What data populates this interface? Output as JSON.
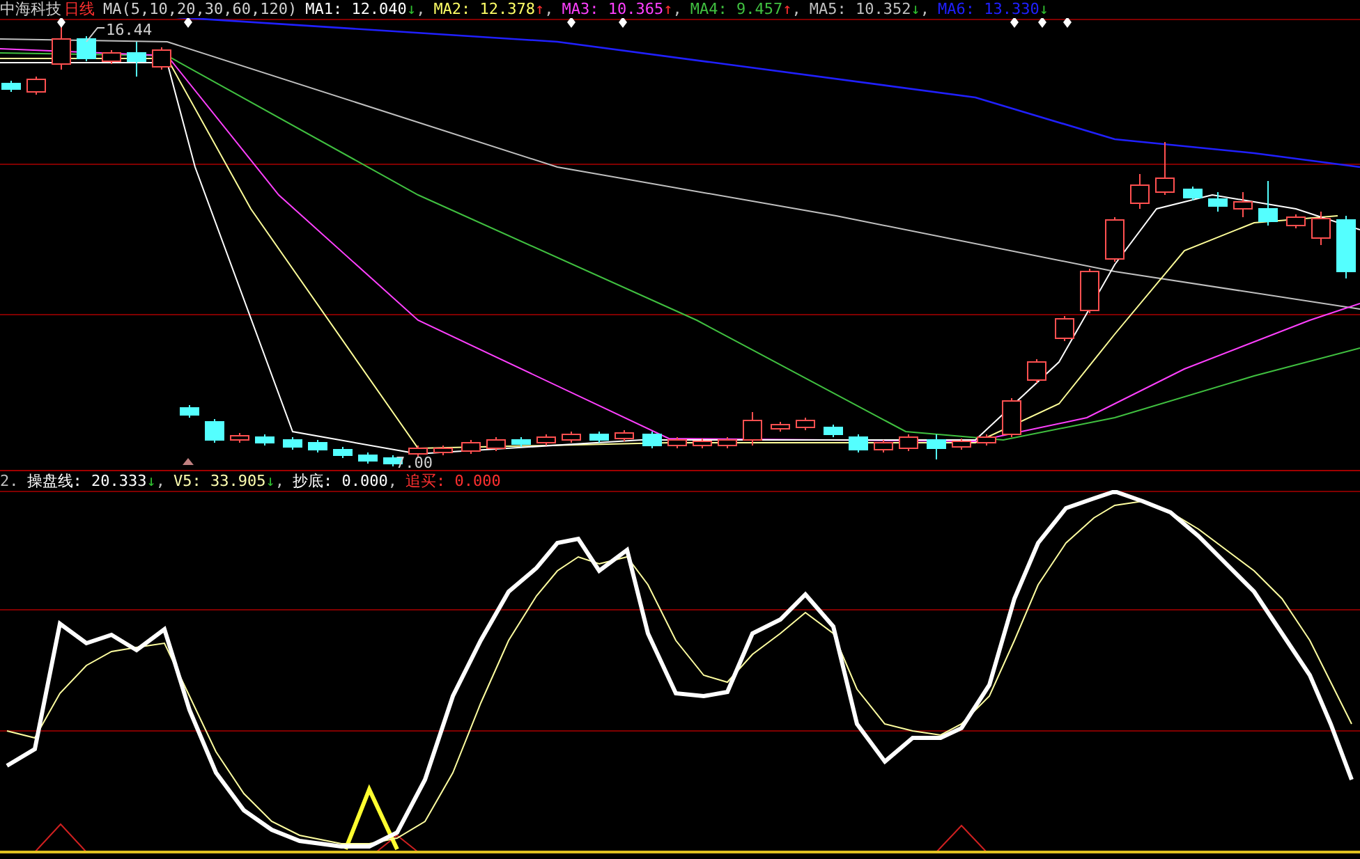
{
  "price_header": {
    "stock": "中海科技",
    "period": "日线",
    "formula": "MA(5,10,20,30,60,120)",
    "separator": ",",
    "items": [
      {
        "label": "MA1: 12.040",
        "arrow": {
          "text": "↓",
          "kind": "down"
        },
        "color": "#ffffff"
      },
      {
        "label": "MA2: 12.378",
        "arrow": {
          "text": "↑",
          "kind": "up"
        },
        "color": "#ffff66"
      },
      {
        "label": "MA3: 10.365",
        "arrow": {
          "text": "↑",
          "kind": "up"
        },
        "color": "#ff40ff"
      },
      {
        "label": "MA4: 9.457",
        "arrow": {
          "text": "↑",
          "kind": "up"
        },
        "color": "#40c040"
      },
      {
        "label": "MA5: 10.352",
        "arrow": {
          "text": "↓",
          "kind": "down"
        },
        "color": "#c0c0c0"
      },
      {
        "label": "MA6: 13.330",
        "arrow": {
          "text": "↓",
          "kind": "down"
        },
        "color": "#2020ff"
      }
    ]
  },
  "price_chart": {
    "high_label": "16.44",
    "low_label": "7.00"
  },
  "indicator_header": {
    "index": "2.",
    "separator": ",",
    "items": [
      {
        "label": "操盘线: 20.333",
        "arrow": {
          "text": "↓",
          "kind": "down"
        },
        "kind": "line"
      },
      {
        "label": "V5: 33.905",
        "arrow": {
          "text": "↓",
          "kind": "down"
        },
        "kind": "average"
      },
      {
        "label": "抄底: 0.000",
        "kind": "bottom"
      },
      {
        "label": "追买: 0.000",
        "kind": "buy"
      }
    ]
  }
}
